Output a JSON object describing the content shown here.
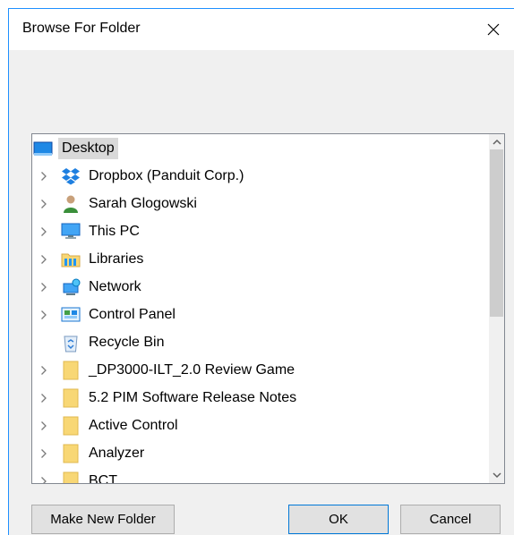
{
  "dialog": {
    "title": "Browse For Folder"
  },
  "tree": {
    "root": {
      "label": "Desktop",
      "icon": "desktop-icon"
    },
    "items": [
      {
        "label": "Dropbox (Panduit Corp.)",
        "icon": "dropbox-icon",
        "expandable": true
      },
      {
        "label": "Sarah Glogowski",
        "icon": "user-icon",
        "expandable": true
      },
      {
        "label": "This PC",
        "icon": "computer-icon",
        "expandable": true
      },
      {
        "label": "Libraries",
        "icon": "libraries-icon",
        "expandable": true
      },
      {
        "label": "Network",
        "icon": "network-icon",
        "expandable": true
      },
      {
        "label": "Control Panel",
        "icon": "control-panel-icon",
        "expandable": true
      },
      {
        "label": "Recycle Bin",
        "icon": "recycle-bin-icon",
        "expandable": false
      },
      {
        "label": "_DP3000-ILT_2.0 Review Game",
        "icon": "folder-icon",
        "expandable": true
      },
      {
        "label": "5.2 PIM Software Release  Notes",
        "icon": "folder-icon",
        "expandable": true
      },
      {
        "label": "Active Control",
        "icon": "folder-icon",
        "expandable": true
      },
      {
        "label": "Analyzer",
        "icon": "folder-icon",
        "expandable": true
      },
      {
        "label": "BCT",
        "icon": "folder-icon",
        "expandable": true
      }
    ],
    "scroll_position": 0.0
  },
  "buttons": {
    "make_new_folder": "Make New Folder",
    "ok": "OK",
    "cancel": "Cancel"
  },
  "colors": {
    "accent": "#0078d7",
    "folder": "#f8d775",
    "selection": "#d9d9d9"
  }
}
